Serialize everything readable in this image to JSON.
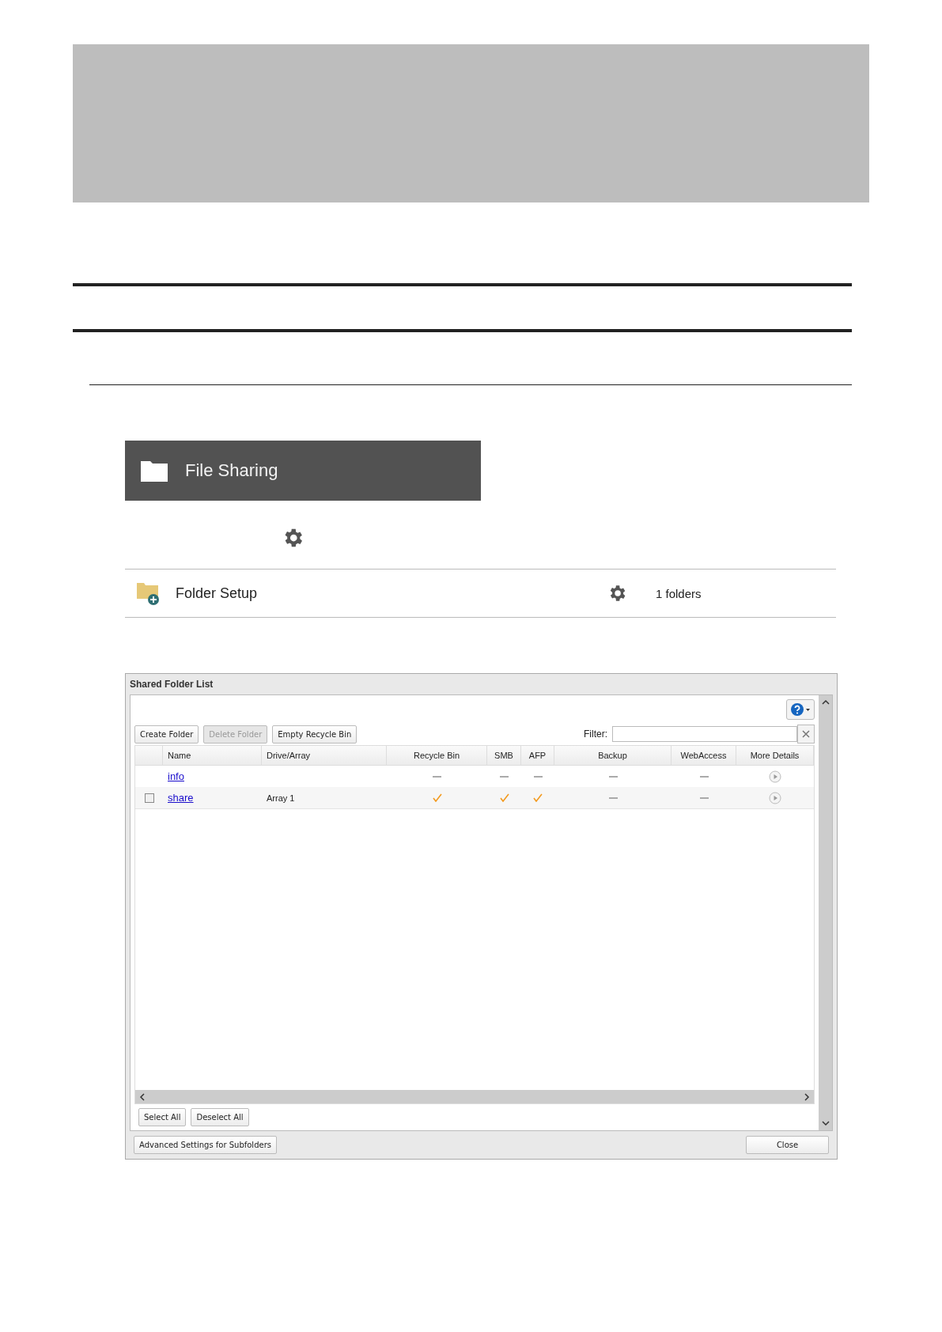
{
  "header_bar": {
    "title": "File Sharing"
  },
  "folder_setup": {
    "label": "Folder Setup",
    "count": "1 folders"
  },
  "dialog": {
    "title": "Shared Folder List",
    "toolbar": [
      {
        "label": "Create Folder",
        "disabled": false
      },
      {
        "label": "Delete Folder",
        "disabled": true
      },
      {
        "label": "Empty Recycle Bin",
        "disabled": false
      }
    ],
    "filter": {
      "label": "Filter:"
    },
    "columns": [
      "Name",
      "Drive/Array",
      "Recycle Bin",
      "SMB",
      "AFP",
      "Backup",
      "WebAccess",
      "More Details"
    ],
    "rows": [
      {
        "name": "info",
        "drive": "",
        "recycle_bin": false,
        "smb": false,
        "afp": false,
        "backup": false,
        "webaccess": false
      },
      {
        "name": "share",
        "checked": false,
        "drive": "Array 1",
        "recycle_bin": true,
        "smb": true,
        "afp": true,
        "backup": false,
        "webaccess": false
      }
    ],
    "bottom_buttons": [
      "Select All",
      "Deselect All"
    ],
    "footer": {
      "advanced": "Advanced Settings for Subfolders",
      "close": "Close"
    }
  }
}
